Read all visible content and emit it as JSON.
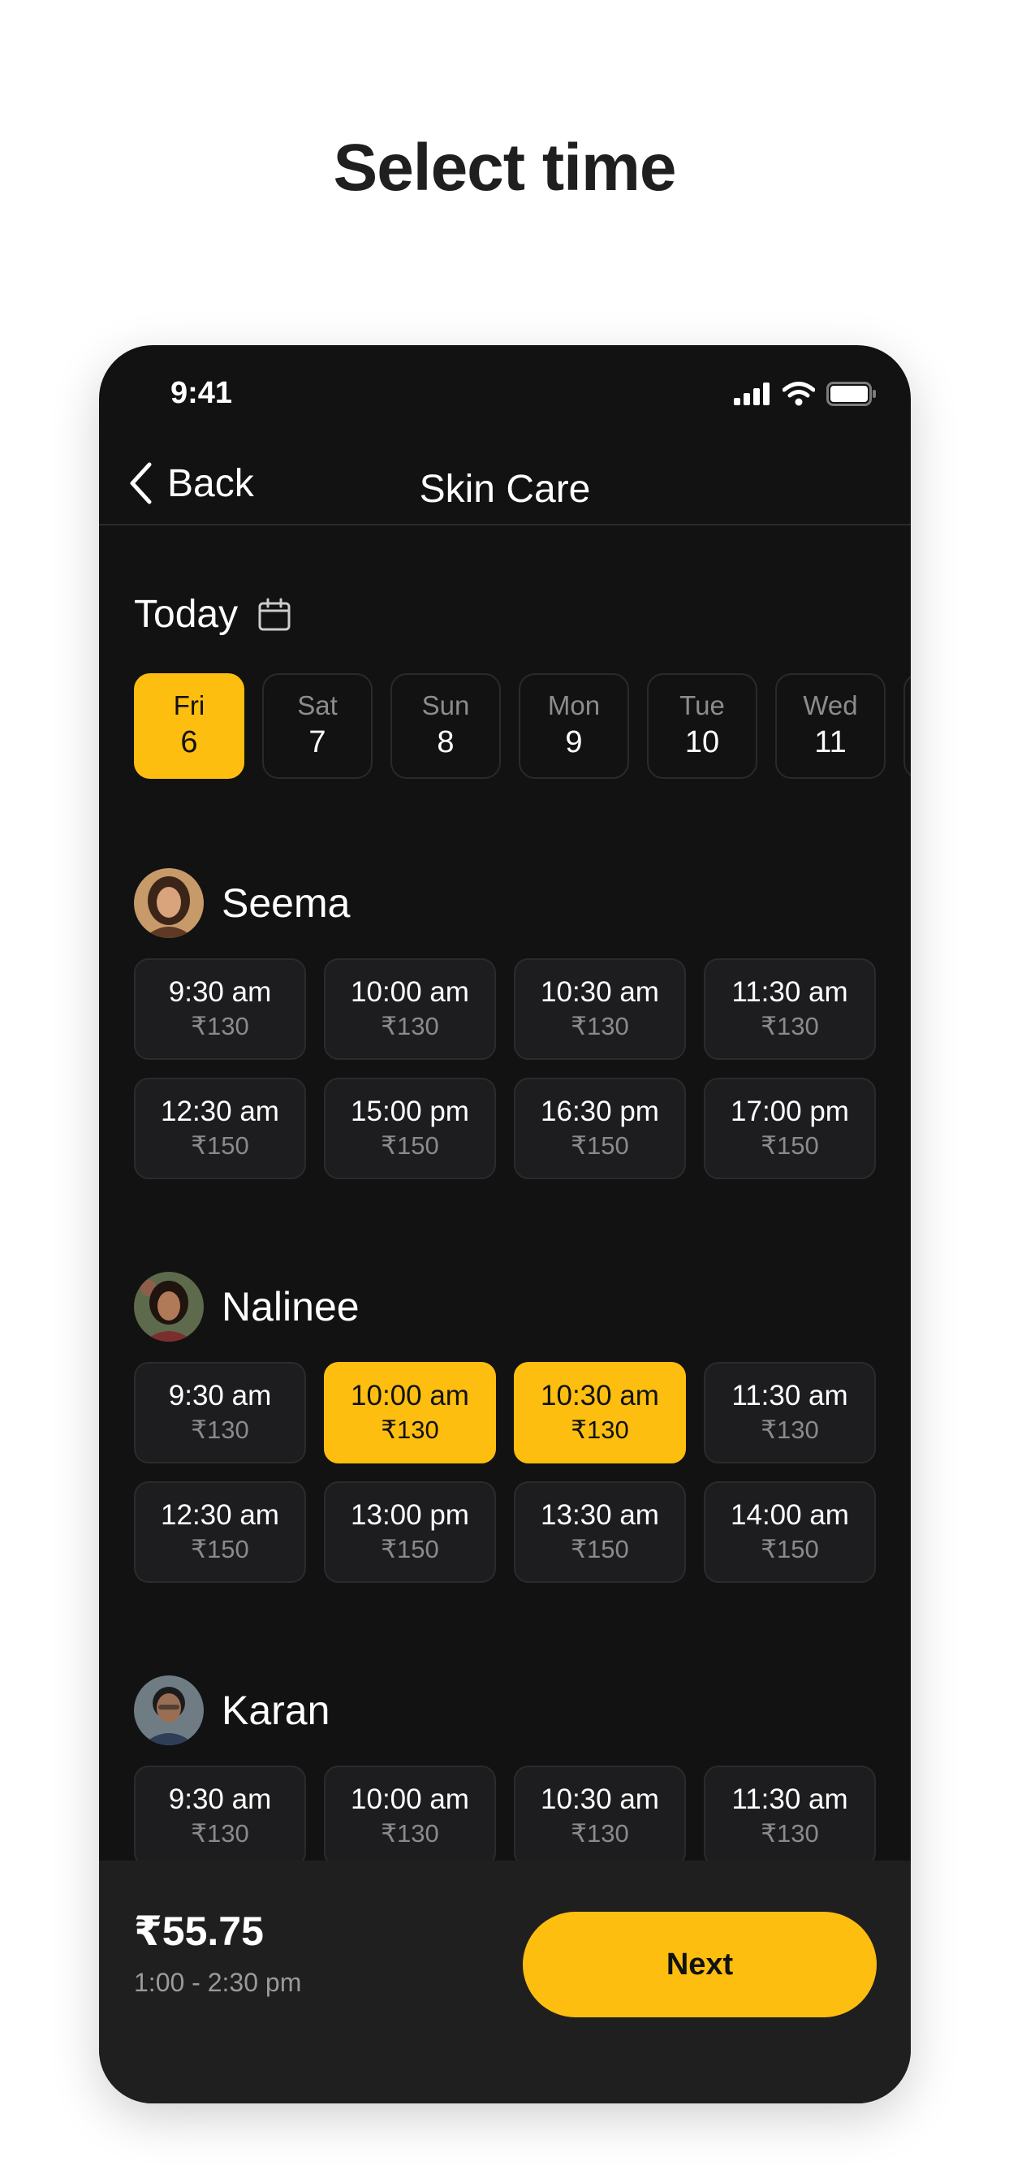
{
  "page_title": "Select time",
  "status_bar": {
    "time": "9:41",
    "icons": [
      "signal-icon",
      "wifi-icon",
      "battery-icon"
    ]
  },
  "nav": {
    "back_label": "Back",
    "title": "Skin Care"
  },
  "date_picker": {
    "label": "Today",
    "icon": "calendar-icon",
    "dates": [
      {
        "day": "Fri",
        "num": "6",
        "selected": true
      },
      {
        "day": "Sat",
        "num": "7"
      },
      {
        "day": "Sun",
        "num": "8"
      },
      {
        "day": "Mon",
        "num": "9"
      },
      {
        "day": "Tue",
        "num": "10"
      },
      {
        "day": "Wed",
        "num": "11"
      }
    ]
  },
  "providers": [
    {
      "name": "Seema",
      "slots": [
        {
          "time": "9:30 am",
          "price": "₹130"
        },
        {
          "time": "10:00 am",
          "price": "₹130"
        },
        {
          "time": "10:30 am",
          "price": "₹130"
        },
        {
          "time": "11:30 am",
          "price": "₹130"
        },
        {
          "time": "12:30 am",
          "price": "₹150"
        },
        {
          "time": "15:00 pm",
          "price": "₹150"
        },
        {
          "time": "16:30 pm",
          "price": "₹150"
        },
        {
          "time": "17:00 pm",
          "price": "₹150"
        }
      ]
    },
    {
      "name": "Nalinee",
      "slots": [
        {
          "time": "9:30 am",
          "price": "₹130"
        },
        {
          "time": "10:00 am",
          "price": "₹130",
          "selected": true
        },
        {
          "time": "10:30 am",
          "price": "₹130",
          "selected": true
        },
        {
          "time": "11:30 am",
          "price": "₹130"
        },
        {
          "time": "12:30 am",
          "price": "₹150"
        },
        {
          "time": "13:00 pm",
          "price": "₹150"
        },
        {
          "time": "13:30 am",
          "price": "₹150"
        },
        {
          "time": "14:00 am",
          "price": "₹150"
        }
      ]
    },
    {
      "name": "Karan",
      "slots": [
        {
          "time": "9:30 am",
          "price": "₹130"
        },
        {
          "time": "10:00 am",
          "price": "₹130"
        },
        {
          "time": "10:30 am",
          "price": "₹130"
        },
        {
          "time": "11:30 am",
          "price": "₹130"
        }
      ]
    }
  ],
  "summary": {
    "price": "₹55.75",
    "time_range": "1:00 - 2:30 pm",
    "next_label": "Next"
  },
  "colors": {
    "accent": "#fdbe10",
    "background": "#121212",
    "card": "#1d1d1f"
  }
}
